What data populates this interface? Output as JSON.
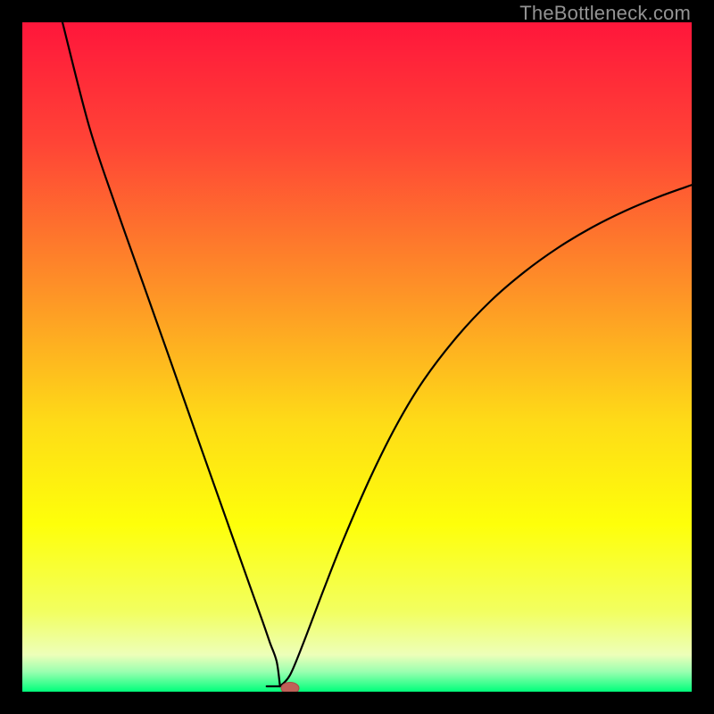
{
  "watermark": {
    "text": "TheBottleneck.com"
  },
  "colors": {
    "gradient_stops": [
      {
        "offset": 0.0,
        "color": "#ff163b"
      },
      {
        "offset": 0.18,
        "color": "#ff4436"
      },
      {
        "offset": 0.4,
        "color": "#fe9227"
      },
      {
        "offset": 0.6,
        "color": "#fedc17"
      },
      {
        "offset": 0.75,
        "color": "#feff0a"
      },
      {
        "offset": 0.88,
        "color": "#f2ff60"
      },
      {
        "offset": 0.945,
        "color": "#edffb9"
      },
      {
        "offset": 0.97,
        "color": "#9bffb0"
      },
      {
        "offset": 1.0,
        "color": "#00ff7b"
      }
    ],
    "curve": "#000000",
    "marker_fill": "#c06058",
    "marker_stroke": "#a84d46"
  },
  "chart_data": {
    "type": "line",
    "title": "",
    "xlabel": "",
    "ylabel": "",
    "xlim": [
      0,
      100
    ],
    "ylim": [
      0,
      100
    ],
    "optimum_x": 38.5,
    "marker": {
      "x": 40,
      "y": 0
    },
    "left_curve": {
      "x": [
        6,
        10,
        14,
        18,
        22,
        26,
        30,
        34,
        36,
        37,
        38,
        38.5
      ],
      "y": [
        100,
        84.4,
        72.4,
        61.1,
        49.8,
        38.4,
        27.1,
        15.8,
        10.2,
        7.3,
        4.5,
        0.8
      ]
    },
    "left_foot_flat": {
      "from_x": 36.5,
      "to_x": 38.5,
      "y": 0.8
    },
    "right_curve": {
      "x": [
        38.5,
        40,
        42,
        45,
        48,
        52,
        56,
        60,
        65,
        70,
        75,
        80,
        85,
        90,
        95,
        100
      ],
      "y": [
        0.8,
        2.5,
        7.3,
        15.2,
        22.8,
        32.0,
        40.0,
        46.6,
        53.1,
        58.4,
        62.7,
        66.3,
        69.3,
        71.8,
        73.9,
        75.7
      ]
    }
  }
}
